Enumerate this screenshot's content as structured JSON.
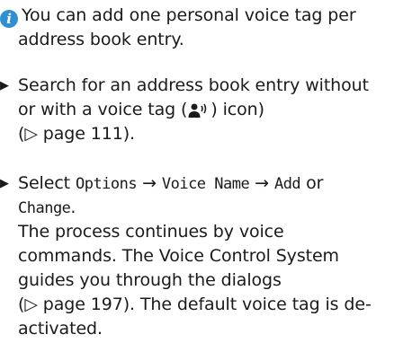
{
  "note": {
    "icon": "info-icon",
    "line1": "You can add one personal voice tag per",
    "line2": "address book entry."
  },
  "step1": {
    "bullet_icon": "triangle-right-icon",
    "line1": "Search for an address book entry without",
    "line2_before": "or with a voice tag (",
    "line2_after": ") icon)",
    "voice_tag_icon": "voice-tag-icon",
    "line3": "(▷ page 111)."
  },
  "step2": {
    "bullet_icon": "triangle-right-icon",
    "select": "Select",
    "options": "Options",
    "voice_name": "Voice Name",
    "add": "Add",
    "or": "or",
    "change": "Change",
    "period": ".",
    "arrow": "→",
    "line2": "The process continues by voice",
    "line3": "commands. The Voice Control System",
    "line4": "guides you through the dialogs",
    "line5": "(▷ page 197). The default voice tag is de-",
    "line6": "activated."
  }
}
